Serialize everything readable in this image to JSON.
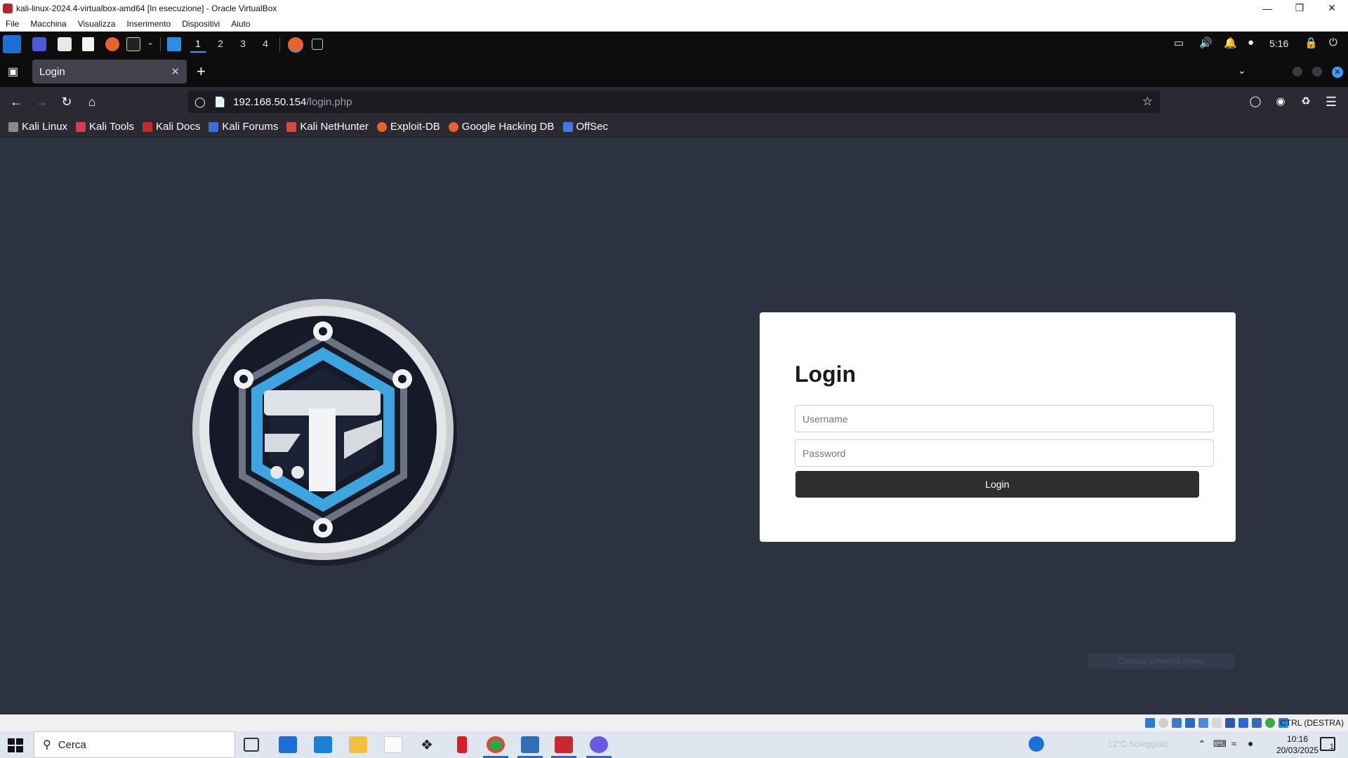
{
  "vbox": {
    "window_title": "kali-linux-2024.4-virtualbox-amd64 [In esecuzione] - Oracle VirtualBox",
    "menu": [
      "File",
      "Macchina",
      "Visualizza",
      "Inserimento",
      "Dispositivi",
      "Aiuto"
    ],
    "host_key": "CTRL (DESTRA)"
  },
  "kali_panel": {
    "workspaces": [
      "1",
      "2",
      "3",
      "4"
    ],
    "active_workspace": "1",
    "clock": "5:16"
  },
  "browser": {
    "tab_title": "Login",
    "url_host": "192.168.50.154",
    "url_path": "/login.php",
    "bookmarks": [
      "Kali Linux",
      "Kali Tools",
      "Kali Docs",
      "Kali Forums",
      "Kali NetHunter",
      "Exploit-DB",
      "Google Hacking DB",
      "OffSec"
    ]
  },
  "page": {
    "login_title": "Login",
    "username_placeholder": "Username",
    "password_placeholder": "Password",
    "login_button": "Login",
    "watermark": "Cattura schermo intero"
  },
  "taskbar": {
    "search_placeholder": "Cerca",
    "weather": "12°C  Soleggiato",
    "time": "10:16",
    "date": "20/03/2025",
    "notification_count": "1"
  },
  "colors": {
    "page_bg": "#2d3240",
    "kali_accent": "#3d9dff",
    "login_button": "#2e2e2e"
  }
}
